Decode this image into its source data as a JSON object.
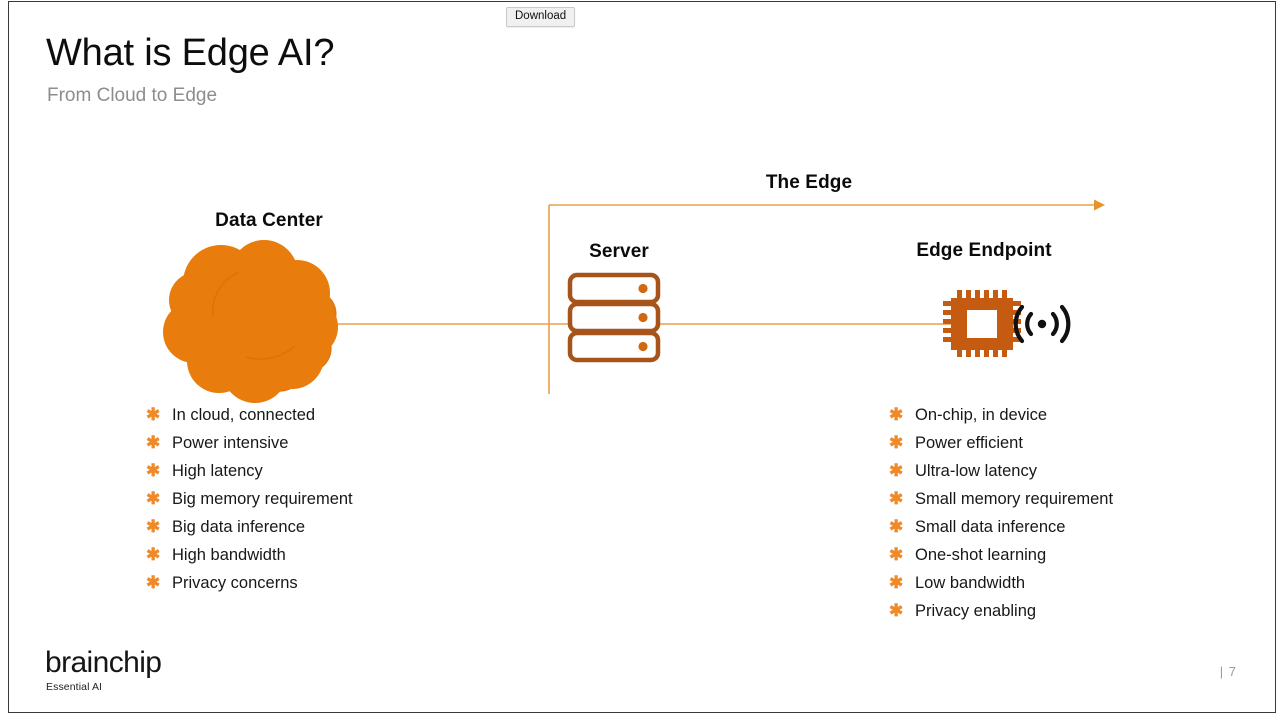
{
  "toolbar": {
    "download_label": "Download"
  },
  "slide": {
    "title": "What is Edge AI?",
    "subtitle": "From Cloud to Edge",
    "diagram": {
      "data_center_label": "Data Center",
      "the_edge_label": "The Edge",
      "server_label": "Server",
      "edge_endpoint_label": "Edge Endpoint",
      "icons": {
        "cloud": "cloud-icon",
        "server": "server-rack-icon",
        "chip": "microchip-icon",
        "wireless": "wireless-signal-icon",
        "arrow": "right-arrow-icon"
      },
      "colors": {
        "cloud_orange": "#e87c0c",
        "line_orange": "#e8a04a",
        "server_brown": "#a6541a",
        "chip_orange": "#c45b11",
        "bullet_orange": "#ef8a2b",
        "heading_black": "#0b0b0b"
      }
    },
    "cloud_bullets": [
      "In cloud, connected",
      "Power intensive",
      "High latency",
      "Big memory requirement",
      "Big data inference",
      "High bandwidth",
      "Privacy concerns"
    ],
    "edge_bullets": [
      "On-chip, in device",
      "Power efficient",
      "Ultra-low latency",
      "Small memory requirement",
      "Small data inference",
      "One-shot learning",
      "Low bandwidth",
      "Privacy enabling"
    ],
    "bullet_glyph": "✱",
    "footer": {
      "brand": "brainchip",
      "tagline": "Essential AI",
      "page_number": "| 7"
    }
  }
}
